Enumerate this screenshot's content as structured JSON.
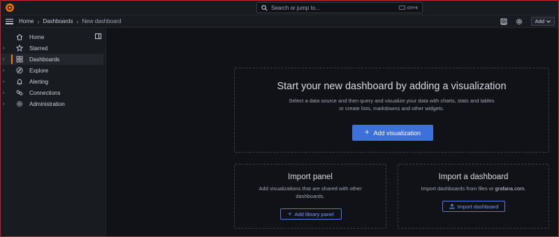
{
  "topbar": {
    "search_placeholder": "Search or jump to...",
    "shortcut": "ctrl+k"
  },
  "breadcrumb": [
    "Home",
    "Dashboards",
    "New dashboard"
  ],
  "toolbar": {
    "add_label": "Add"
  },
  "sidebar": {
    "items": [
      {
        "label": "Home",
        "icon": "home-icon",
        "expandable": false,
        "active": false
      },
      {
        "label": "Starred",
        "icon": "star-icon",
        "expandable": true,
        "active": false
      },
      {
        "label": "Dashboards",
        "icon": "apps-icon",
        "expandable": true,
        "active": true
      },
      {
        "label": "Explore",
        "icon": "compass-icon",
        "expandable": true,
        "active": false
      },
      {
        "label": "Alerting",
        "icon": "bell-icon",
        "expandable": true,
        "active": false
      },
      {
        "label": "Connections",
        "icon": "link-icon",
        "expandable": true,
        "active": false
      },
      {
        "label": "Administration",
        "icon": "cog-icon",
        "expandable": true,
        "active": false
      }
    ]
  },
  "main": {
    "hero": {
      "title": "Start your new dashboard by adding a visualization",
      "description": "Select a data source and then query and visualize your data with charts, stats and tables or create lists, markdowns and other widgets.",
      "button_label": "Add visualization"
    },
    "import_panel": {
      "title": "Import panel",
      "description": "Add visualizations that are shared with other dashboards.",
      "button_label": "Add library panel"
    },
    "import_dashboard": {
      "title": "Import a dashboard",
      "description_prefix": "Import dashboards from files or ",
      "description_link": "grafana.com",
      "description_suffix": ".",
      "button_label": "Import dashboard"
    }
  },
  "colors": {
    "accent_orange": "#f27b21",
    "primary_blue": "#3d71d9",
    "background": "#111217",
    "panel": "#181b1f"
  }
}
